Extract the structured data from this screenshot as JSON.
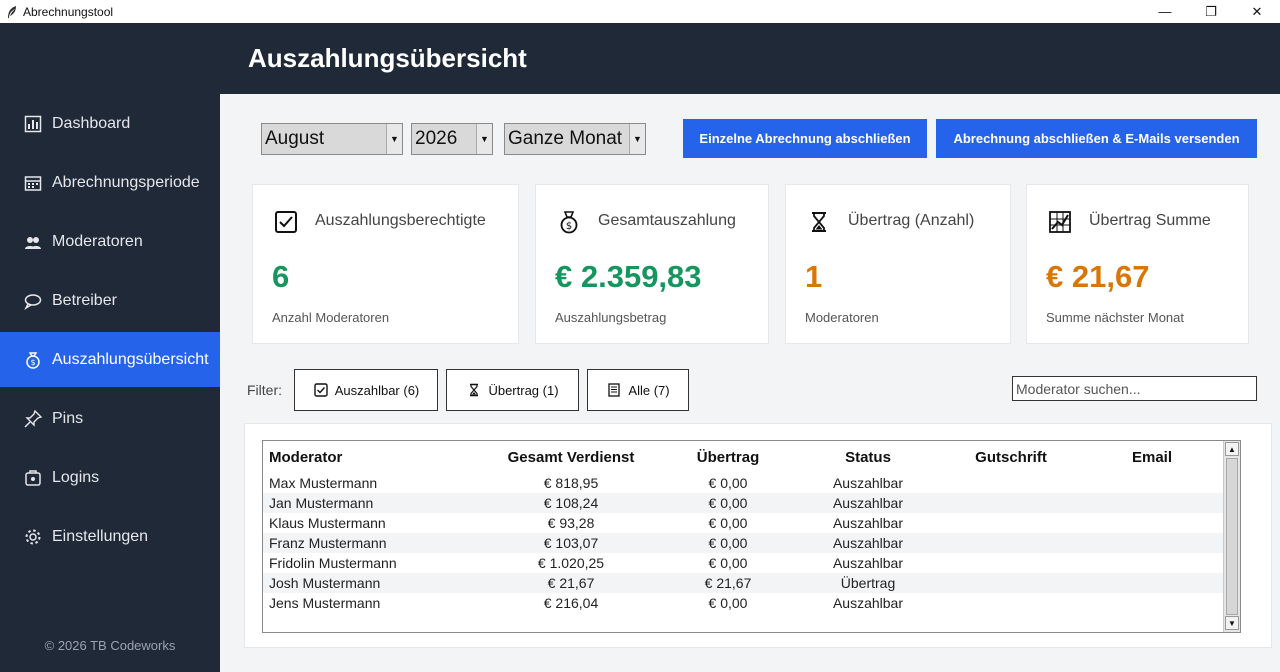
{
  "window": {
    "title": "Abrechnungstool",
    "icon": "feather-icon",
    "controls": {
      "minimize": "—",
      "maximize": "❐",
      "close": "✕"
    }
  },
  "header": {
    "title": "Auszahlungsübersicht"
  },
  "sidebar": {
    "items": [
      {
        "label": "Dashboard",
        "icon": "bar-chart-icon",
        "active": false
      },
      {
        "label": "Abrechnungsperiode",
        "icon": "calendar-icon",
        "active": false
      },
      {
        "label": "Moderatoren",
        "icon": "users-icon",
        "active": false
      },
      {
        "label": "Betreiber",
        "icon": "chat-bubble-icon",
        "active": false
      },
      {
        "label": "Auszahlungsübersicht",
        "icon": "money-bag-icon",
        "active": true
      },
      {
        "label": "Pins",
        "icon": "pin-icon",
        "active": false
      },
      {
        "label": "Logins",
        "icon": "login-icon",
        "active": false
      },
      {
        "label": "Einstellungen",
        "icon": "gear-icon",
        "active": false
      }
    ],
    "footer": "© 2026 TB Codeworks"
  },
  "controls": {
    "month": "August",
    "year": "2026",
    "period": "Ganze Monat",
    "single_close_label": "Einzelne Abrechnung abschließen",
    "close_send_label": "Abrechnung abschließen & E-Mails versenden"
  },
  "cards": [
    {
      "title": "Auszahlungsberechtigte",
      "value": "6",
      "subtitle": "Anzahl Moderatoren",
      "icon": "checkbox-icon",
      "color": "#15965f"
    },
    {
      "title": "Gesamtauszahlung",
      "value": "€ 2.359,83",
      "subtitle": "Auszahlungsbetrag",
      "icon": "money-bag-icon",
      "color": "#15965f"
    },
    {
      "title": "Übertrag (Anzahl)",
      "value": "1",
      "subtitle": "Moderatoren",
      "icon": "hourglass-icon",
      "color": "#d97706"
    },
    {
      "title": "Übertrag Summe",
      "value": "€ 21,67",
      "subtitle": "Summe nächster Monat",
      "icon": "chart-icon",
      "color": "#d97706"
    }
  ],
  "filter": {
    "label": "Filter:",
    "buttons": [
      {
        "label": "Auszahlbar (6)",
        "icon": "checkbox-icon"
      },
      {
        "label": "Übertrag (1)",
        "icon": "hourglass-icon"
      },
      {
        "label": "Alle (7)",
        "icon": "list-icon"
      }
    ],
    "search_placeholder": "Moderator suchen..."
  },
  "table": {
    "columns": [
      "Moderator",
      "Gesamt Verdienst",
      "Übertrag",
      "Status",
      "Gutschrift",
      "Email"
    ],
    "rows": [
      [
        "Max Mustermann",
        "€ 818,95",
        "€ 0,00",
        "Auszahlbar",
        "",
        ""
      ],
      [
        "Jan Mustermann",
        "€ 108,24",
        "€ 0,00",
        "Auszahlbar",
        "",
        ""
      ],
      [
        "Klaus Mustermann",
        "€ 93,28",
        "€ 0,00",
        "Auszahlbar",
        "",
        ""
      ],
      [
        "Franz Mustermann",
        "€ 103,07",
        "€ 0,00",
        "Auszahlbar",
        "",
        ""
      ],
      [
        "Fridolin Mustermann",
        "€ 1.020,25",
        "€ 0,00",
        "Auszahlbar",
        "",
        ""
      ],
      [
        "Josh Mustermann",
        "€ 21,67",
        "€ 21,67",
        "Übertrag",
        "",
        ""
      ],
      [
        "Jens Mustermann",
        "€ 216,04",
        "€ 0,00",
        "Auszahlbar",
        "",
        ""
      ]
    ]
  },
  "colors": {
    "sidebar_bg": "#1f2937",
    "accent": "#2563eb",
    "green": "#15965f",
    "orange": "#d97706"
  }
}
